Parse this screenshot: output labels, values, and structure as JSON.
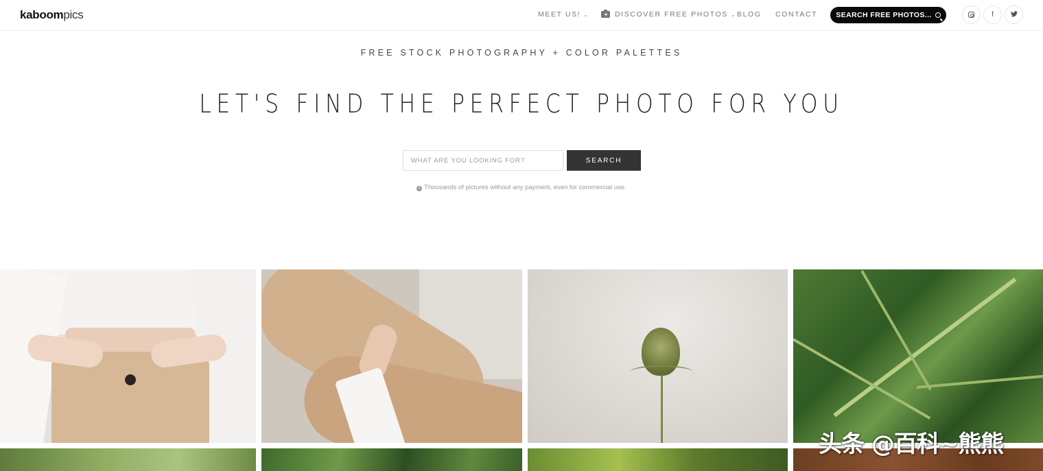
{
  "header": {
    "logo": {
      "bold": "kaboom",
      "light": "pics"
    },
    "nav": [
      {
        "label": "MEET US!",
        "dropdown": true
      },
      {
        "label": "DISCOVER FREE PHOTOS",
        "dropdown": true,
        "icon": "camera-icon"
      },
      {
        "label": "BLOG",
        "dropdown": false
      },
      {
        "label": "CONTACT",
        "dropdown": false
      }
    ],
    "search_button": "SEARCH FREE PHOTOS...",
    "social": [
      "instagram-icon",
      "facebook-icon",
      "twitter-icon"
    ],
    "social_glyphs": {
      "facebook": "f",
      "twitter": "🐦"
    }
  },
  "hero": {
    "tagline": "FREE STOCK PHOTOGRAPHY + COLOR PALETTES",
    "headline": "LET'S FIND THE PERFECT PHOTO FOR YOU",
    "search_placeholder": "WHAT ARE YOU LOOKING FOR?",
    "search_button": "SEARCH",
    "note": "Thousands of pictures without any payment, even for commercial use."
  },
  "watermark": "头条 @百科~熊熊",
  "colors": {
    "pill_bg": "#0a0a0a",
    "search_btn_bg": "#343434",
    "nav_text": "#777777"
  }
}
